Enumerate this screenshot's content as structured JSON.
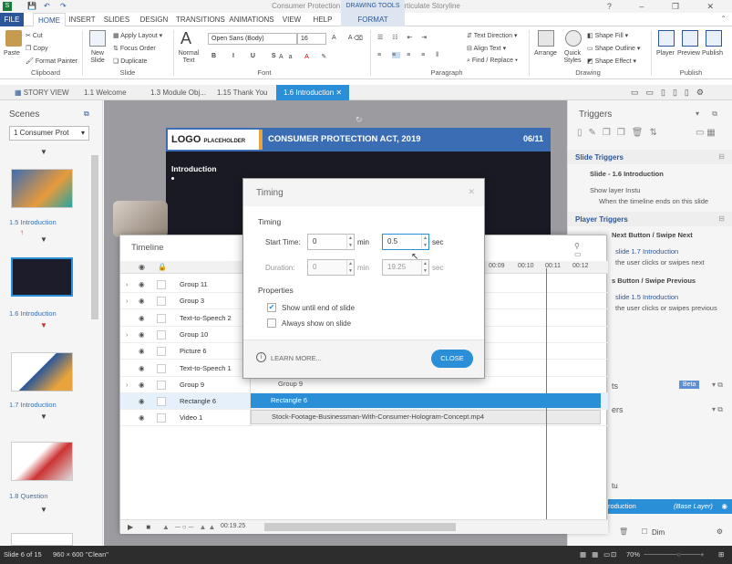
{
  "window": {
    "title": "Consumer Protection Act, 2019.story* - Articulate Storyline",
    "context_tab": "DRAWING TOOLS"
  },
  "ribbon_tabs": [
    "FILE",
    "HOME",
    "INSERT",
    "SLIDES",
    "DESIGN",
    "TRANSITIONS",
    "ANIMATIONS",
    "VIEW",
    "HELP",
    "FORMAT"
  ],
  "clipboard": {
    "paste": "Paste",
    "cut": "Cut",
    "copy": "Copy",
    "format_painter": "Format Painter",
    "label": "Clipboard"
  },
  "slide_group": {
    "new_slide": "New Slide",
    "apply_layout": "Apply Layout",
    "focus_order": "Focus Order",
    "duplicate": "Duplicate",
    "label": "Slide"
  },
  "font_group": {
    "normal_text": "Normal Text",
    "font_name": "Open Sans (Body)",
    "font_size": "16",
    "label": "Font"
  },
  "paragraph_group": {
    "text_direction": "Text Direction",
    "align_text": "Align Text",
    "find_replace": "Find / Replace",
    "label": "Paragraph"
  },
  "drawing_group": {
    "arrange": "Arrange",
    "quick_styles": "Quick Styles",
    "shape_fill": "Shape Fill",
    "shape_outline": "Shape Outline",
    "shape_effect": "Shape Effect",
    "label": "Drawing"
  },
  "publish_group": {
    "player": "Player",
    "preview": "Preview",
    "publish": "Publish",
    "label": "Publish"
  },
  "doc_tabs": [
    "STORY VIEW",
    "1.1 Welcome",
    "1.3 Module Obj...",
    "1.15 Thank You",
    "1.6 Introduction"
  ],
  "scenes": {
    "title": "Scenes",
    "selector": "1 Consumer Prot",
    "slides": [
      {
        "label": "1.5 Introduction"
      },
      {
        "label": "1.6 Introduction"
      },
      {
        "label": "1.7 Introduction"
      },
      {
        "label": "1.8 Question"
      }
    ]
  },
  "slide": {
    "logo": "LOGO",
    "logo_sub": "PLACEHOLDER",
    "heading": "CONSUMER PROTECTION ACT, 2019",
    "page": "06/11",
    "intro": "Introduction"
  },
  "triggers": {
    "title": "Triggers",
    "slide_triggers": "Slide Triggers",
    "slide_name": "Slide - 1.6 Introduction",
    "show_layer": "Show layer Instu",
    "when_text": "When the timeline ends on this slide",
    "player_triggers": "Player Triggers",
    "next_btn": "Next Button / Swipe Next",
    "next_target": "slide 1.7 Introduction",
    "next_when": "the user clicks or swipes next",
    "prev_btn": "s Button / Swipe Previous",
    "prev_target": "slide 1.5 Introduction",
    "prev_when": "the user clicks or swipes previous",
    "states": "ts",
    "beta": "Beta",
    "layers": "ers",
    "layer_instu": "tu",
    "base_layer": "roduction",
    "base_layer_tag": "(Base Layer)",
    "dim": "Dim"
  },
  "timeline": {
    "title": "Timeline",
    "ticks": [
      "00:09",
      "00:10",
      "00:11",
      "00:12"
    ],
    "rows": [
      {
        "name": "Group 11",
        "expand": true
      },
      {
        "name": "Group 3",
        "expand": true
      },
      {
        "name": "Text-to-Speech 2",
        "expand": false
      },
      {
        "name": "Group 10",
        "expand": true
      },
      {
        "name": "Picture 6",
        "expand": false
      },
      {
        "name": "Text-to-Speech 1",
        "expand": false
      },
      {
        "name": "Group 9",
        "expand": true
      },
      {
        "name": "Rectangle 6",
        "expand": false
      },
      {
        "name": "Video 1",
        "expand": false
      }
    ],
    "bar_group9": "Group 9",
    "bar_rect6": "Rectangle 6",
    "bar_video": "Stock-Footage-Businessman-With-Consumer-Hologram-Concept.mp4",
    "time": "00:19.25"
  },
  "dialog": {
    "title": "Timing",
    "section_timing": "Timing",
    "start_label": "Start Time:",
    "start_min": "0",
    "start_sec": "0.5",
    "duration_label": "Duration:",
    "dur_min": "0",
    "dur_sec": "19.25",
    "unit_min": "min",
    "unit_sec": "sec",
    "section_props": "Properties",
    "show_until_end": "Show until end of slide",
    "always_show": "Always show on slide",
    "learn_more": "LEARN MORE...",
    "close": "CLOSE"
  },
  "status": {
    "slide": "Slide 6 of 15",
    "size": "960 × 600",
    "state": "\"Clean\"",
    "zoom": "70%"
  }
}
